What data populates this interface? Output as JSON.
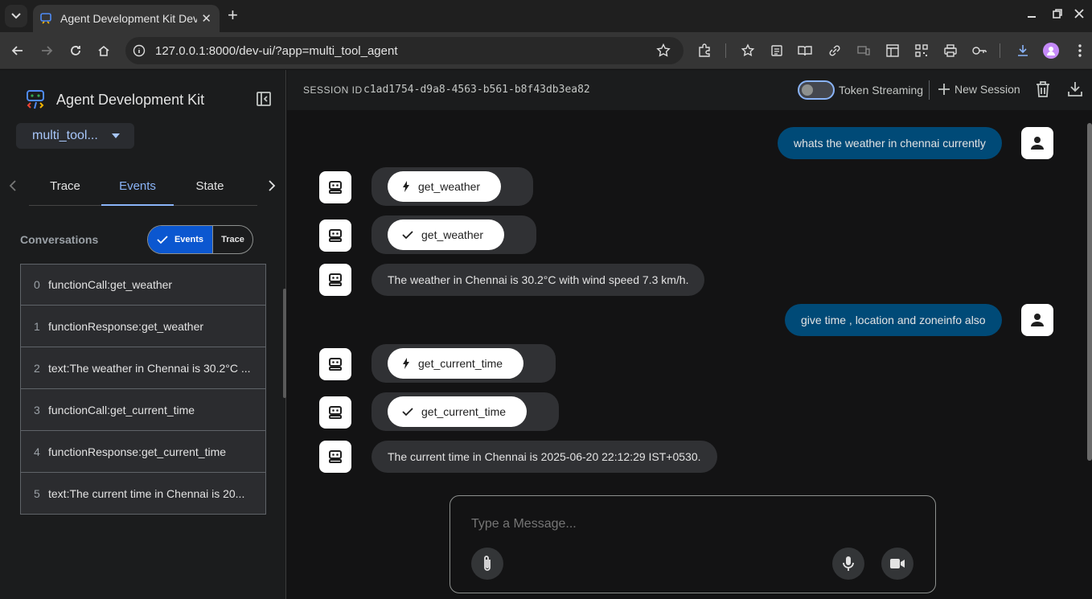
{
  "browser": {
    "tab_title": "Agent Development Kit Dev UI",
    "tab_close": "✕",
    "new_tab": "+",
    "url_host": "127.0.0.1",
    "url_rest": ":8000/dev-ui/?app=multi_tool_agent"
  },
  "sidebar": {
    "brand_title": "Agent Development Kit",
    "app_select": "multi_tool...",
    "tabs": [
      "Trace",
      "Events",
      "State"
    ],
    "active_tab": "Events",
    "conversations_label": "Conversations",
    "toggle": {
      "events": "Events",
      "trace": "Trace"
    },
    "events": [
      {
        "idx": "0",
        "label": "functionCall:get_weather"
      },
      {
        "idx": "1",
        "label": "functionResponse:get_weather"
      },
      {
        "idx": "2",
        "label": "text:The weather in Chennai is 30.2°C ..."
      },
      {
        "idx": "3",
        "label": "functionCall:get_current_time"
      },
      {
        "idx": "4",
        "label": "functionResponse:get_current_time"
      },
      {
        "idx": "5",
        "label": "text:The current time in Chennai is 20..."
      }
    ]
  },
  "session": {
    "label": "SESSION ID",
    "id": "c1ad1754-d9a8-4563-b561-b8f43db3ea82",
    "token_streaming": "Token Streaming",
    "new_session": "New Session"
  },
  "chat": {
    "user_msg_1": "whats the weather in chennai currently",
    "call_1": "get_weather",
    "response_1": "get_weather",
    "bot_text_1": "The weather in Chennai is 30.2°C with wind speed 7.3 km/h.",
    "user_msg_2": "give time , location and zoneinfo also",
    "call_2": "get_current_time",
    "response_2": "get_current_time",
    "bot_text_2": "The current time in Chennai is 2025-06-20 22:12:29 IST+0530."
  },
  "composer": {
    "placeholder": "Type a Message..."
  },
  "colors": {
    "accent": "#8ab4f8",
    "user_bubble": "#004a77",
    "selected_toggle": "#0b57d0"
  }
}
